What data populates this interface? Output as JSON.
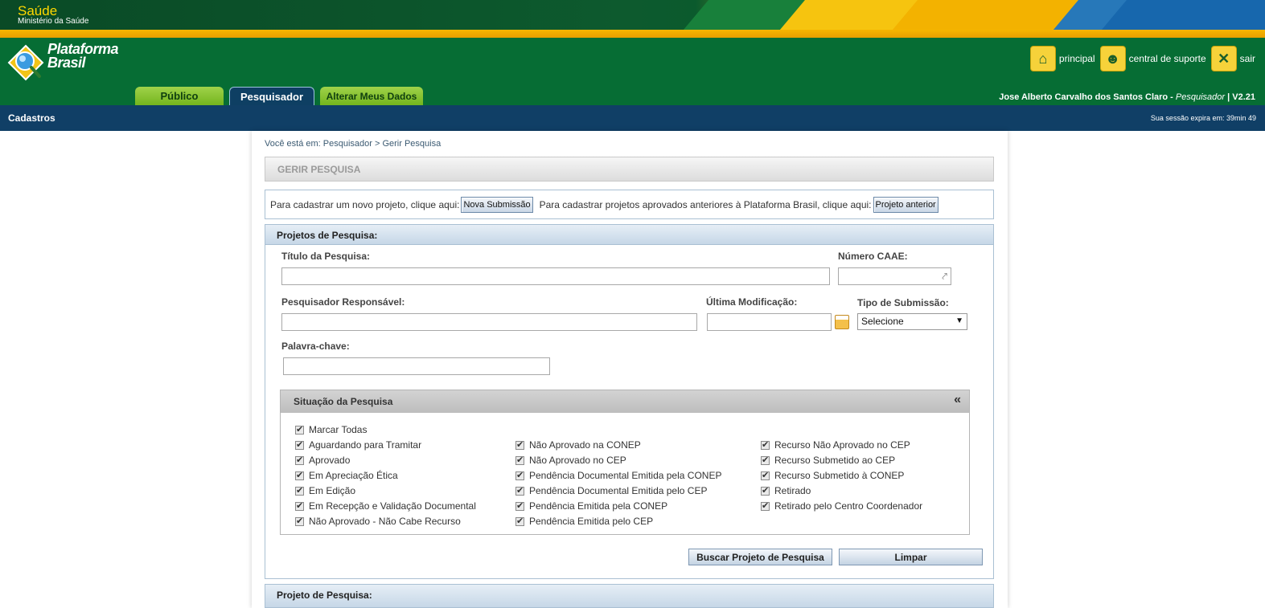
{
  "gov": {
    "title": "Saúde",
    "subtitle": "Ministério da Saúde"
  },
  "brand": {
    "logo_line1": "Plataforma",
    "logo_line2": "Brasil"
  },
  "top_links": {
    "principal": "principal",
    "suporte": "central de suporte",
    "sair": "sair"
  },
  "tabs": {
    "publico": "Público",
    "pesquisador": "Pesquisador",
    "alterar": "Alterar Meus Dados"
  },
  "user": {
    "name": "Jose Alberto Carvalho dos Santos Claro - ",
    "role": "Pesquisador",
    "version": " | V2.21"
  },
  "navbar": {
    "cadastros": "Cadastros",
    "session": "Sua sessão expira em: 39min 49"
  },
  "breadcrumb": "Você está em: Pesquisador > Gerir Pesquisa",
  "page_title": "GERIR PESQUISA",
  "submit_row": {
    "text1": "Para cadastrar um novo projeto, clique aqui:",
    "btn1": "Nova Submissão",
    "text2": "Para cadastrar projetos aprovados anteriores à Plataforma Brasil, clique aqui:",
    "btn2": "Projeto anterior"
  },
  "search_panel": {
    "title": "Projetos de Pesquisa:",
    "titulo_label": "Título da Pesquisa:",
    "caae_label": "Número CAAE:",
    "responsavel_label": "Pesquisador Responsável:",
    "modificacao_label": "Última Modificação:",
    "tipo_label": "Tipo de Submissão:",
    "tipo_value": "Selecione",
    "palavra_label": "Palavra-chave:"
  },
  "situacao": {
    "title": "Situação da Pesquisa",
    "collapse": "«",
    "col1": [
      "Marcar Todas",
      "Aguardando para Tramitar",
      "Aprovado",
      "Em Apreciação Ética",
      "Em Edição",
      "Em Recepção e Validação Documental",
      "Não Aprovado - Não Cabe Recurso"
    ],
    "col2": [
      "Não Aprovado na CONEP",
      "Não Aprovado no CEP",
      "Pendência Documental Emitida pela CONEP",
      "Pendência Documental Emitida pelo CEP",
      "Pendência Emitida pela CONEP",
      "Pendência Emitida pelo CEP"
    ],
    "col3": [
      "Recurso Não Aprovado no CEP",
      "Recurso Submetido ao CEP",
      "Recurso Submetido à CONEP",
      "Retirado",
      "Retirado pelo Centro Coordenador"
    ]
  },
  "buttons": {
    "buscar": "Buscar Projeto de Pesquisa",
    "limpar": "Limpar"
  },
  "results_panel": {
    "title": "Projeto de Pesquisa:"
  }
}
